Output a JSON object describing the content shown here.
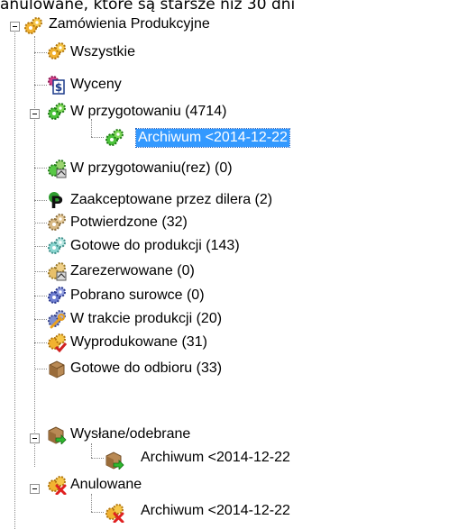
{
  "caption": "anulowane, które są starsze niż 30 dni",
  "tree": {
    "root": {
      "label": "Zamówienia Produkcyjne",
      "icon": "gears-gold-icon"
    },
    "items": [
      {
        "label": "Wszystkie",
        "icon": "gears-gold-icon"
      },
      {
        "label": "Wyceny",
        "icon": "price-document-icon"
      },
      {
        "label": "W przygotowaniu (4714)",
        "icon": "gears-green-icon"
      },
      {
        "label": "Archiwum <2014-12-22",
        "icon": "gears-green-icon"
      },
      {
        "label": "W przygotowaniu(rez) (0)",
        "icon": "gears-reserved-icon"
      },
      {
        "label": "Zaakceptowane przez dilera (2)",
        "icon": "parking-p-icon"
      },
      {
        "label": "Potwierdzone (32)",
        "icon": "gears-tan-icon"
      },
      {
        "label": "Gotowe do produkcji (143)",
        "icon": "gears-teal-icon"
      },
      {
        "label": "Zarezerwowane (0)",
        "icon": "gears-reserved-icon"
      },
      {
        "label": "Pobrano surowce (0)",
        "icon": "gears-blue-icon"
      },
      {
        "label": "W trakcie produkcji (20)",
        "icon": "gears-wrench-icon"
      },
      {
        "label": "Wyprodukowane (31)",
        "icon": "gears-check-icon"
      },
      {
        "label": "Gotowe do odbioru (33)",
        "icon": "package-icon"
      },
      {
        "label": "Wysłane/odebrane",
        "icon": "package-arrow-icon"
      },
      {
        "label": "Archiwum <2014-12-22",
        "icon": "package-arrow-icon"
      },
      {
        "label": "Anulowane",
        "icon": "gears-cancel-icon"
      },
      {
        "label": "Archiwum <2014-12-22",
        "icon": "gears-cancel-icon"
      }
    ],
    "selected_index": 3
  },
  "colors": {
    "selection": "#3399ff",
    "tree_lines": "#8a8a8a"
  }
}
